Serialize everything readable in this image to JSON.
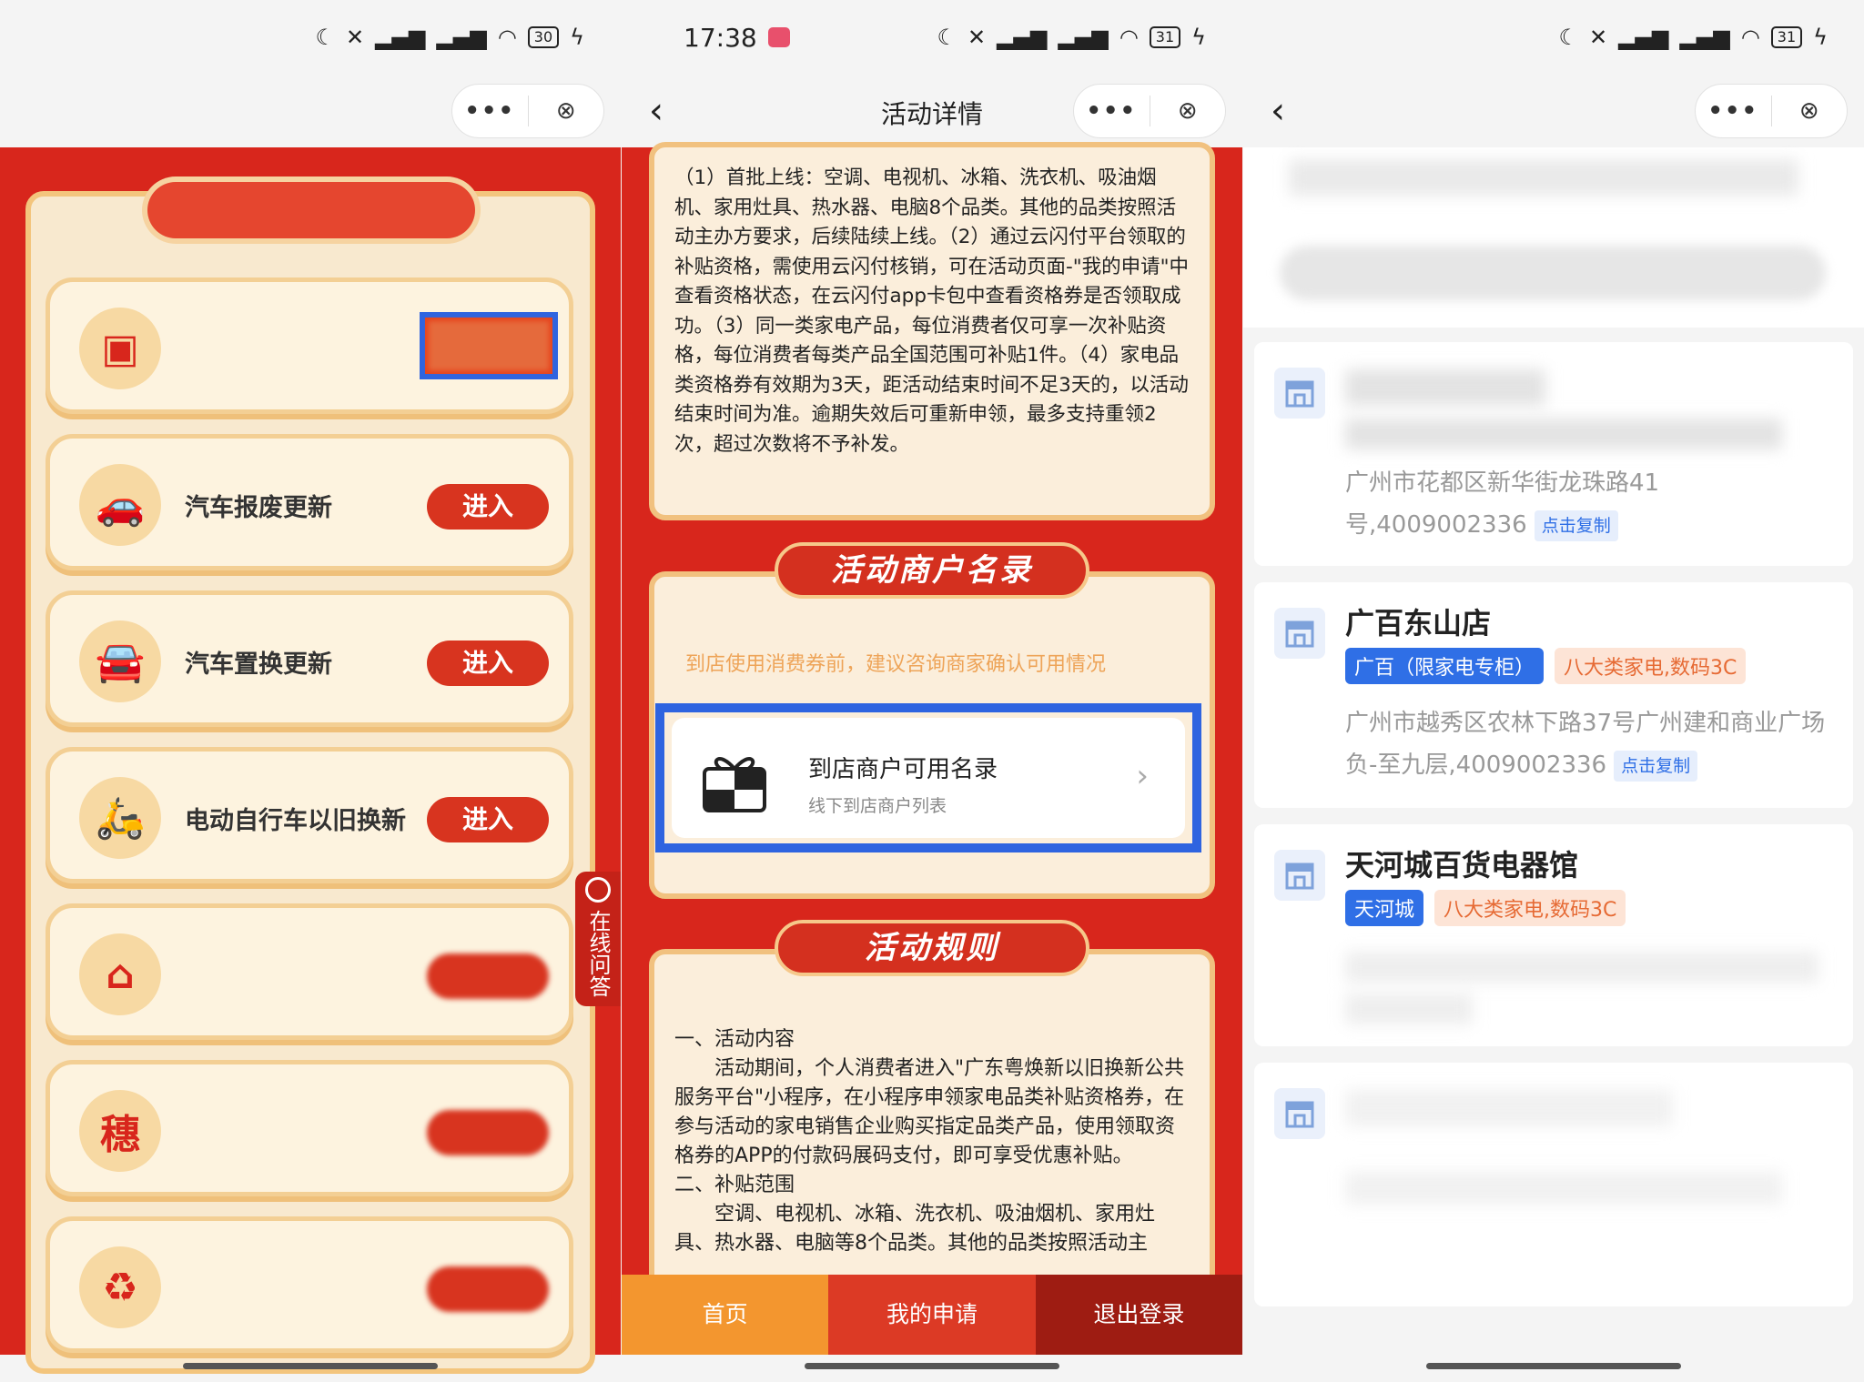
{
  "statusbar": {
    "time": "17:38",
    "battery_left": "30",
    "battery_mid": "31",
    "battery_right": "31"
  },
  "capsule": {
    "more": "•••",
    "close": "⊗"
  },
  "panel1": {
    "services": [
      {
        "label": "",
        "button": ""
      },
      {
        "label": "汽车报废更新",
        "button": "进入"
      },
      {
        "label": "汽车置换更新",
        "button": "进入"
      },
      {
        "label": "电动自行车以旧换新",
        "button": "进入"
      },
      {
        "label": "",
        "button": ""
      },
      {
        "label": "",
        "button": ""
      },
      {
        "label": "",
        "button": ""
      }
    ],
    "qa_tab": "在线问答"
  },
  "panel2": {
    "title": "活动详情",
    "rules_text": "（1）首批上线：空调、电视机、冰箱、洗衣机、吸油烟机、家用灶具、热水器、电脑8个品类。其他的品类按照活动主办方要求，后续陆续上线。（2）通过云闪付平台领取的补贴资格，需使用云闪付核销，可在活动页面-\"我的申请\"中查看资格状态，在云闪付app卡包中查看资格券是否领取成功。（3）同一类家电产品，每位消费者仅可享一次补贴资格，每位消费者每类产品全国范围可补贴1件。（4）家电品类资格券有效期为3天，距活动结束时间不足3天的，以活动结束时间为准。逾期失效后可重新申领，最多支持重领2次，超过次数将不予补发。",
    "merchant_ribbon": "活动商户名录",
    "merchant_tip": "到店使用消费券前，建议咨询商家确认可用情况",
    "merchant_title": "到店商户可用名录",
    "merchant_sub": "线下到店商户列表",
    "rules_ribbon": "活动规则",
    "rules2_h1": "一、活动内容",
    "rules2_p1": "活动期间，个人消费者进入\"广东粤焕新以旧换新公共服务平台\"小程序，在小程序申领家电品类补贴资格券，在参与活动的家电销售企业购买指定品类产品，使用领取资格券的APP的付款码展码支付，即可享受优惠补贴。",
    "rules2_h2": "二、补贴范围",
    "rules2_p2": "空调、电视机、冰箱、洗衣机、吸油烟机、家用灶具、热水器、电脑等8个品类。其他的品类按照活动主",
    "tabs": {
      "home": "首页",
      "mine": "我的申请",
      "logout": "退出登录"
    }
  },
  "panel3": {
    "store1": {
      "addr": "广州市花都区新华街龙珠路41号,4009002336",
      "copy": "点击复制"
    },
    "store2": {
      "name": "广百东山店",
      "tag1": "广百（限家电专柜）",
      "tag2": "八大类家电,数码3C",
      "addr": "广州市越秀区农林下路37号广州建和商业广场负-至九层,4009002336",
      "copy": "点击复制"
    },
    "store3": {
      "name": "天河城百货电器馆",
      "tag1": "天河城",
      "tag2": "八大类家电,数码3C"
    }
  }
}
